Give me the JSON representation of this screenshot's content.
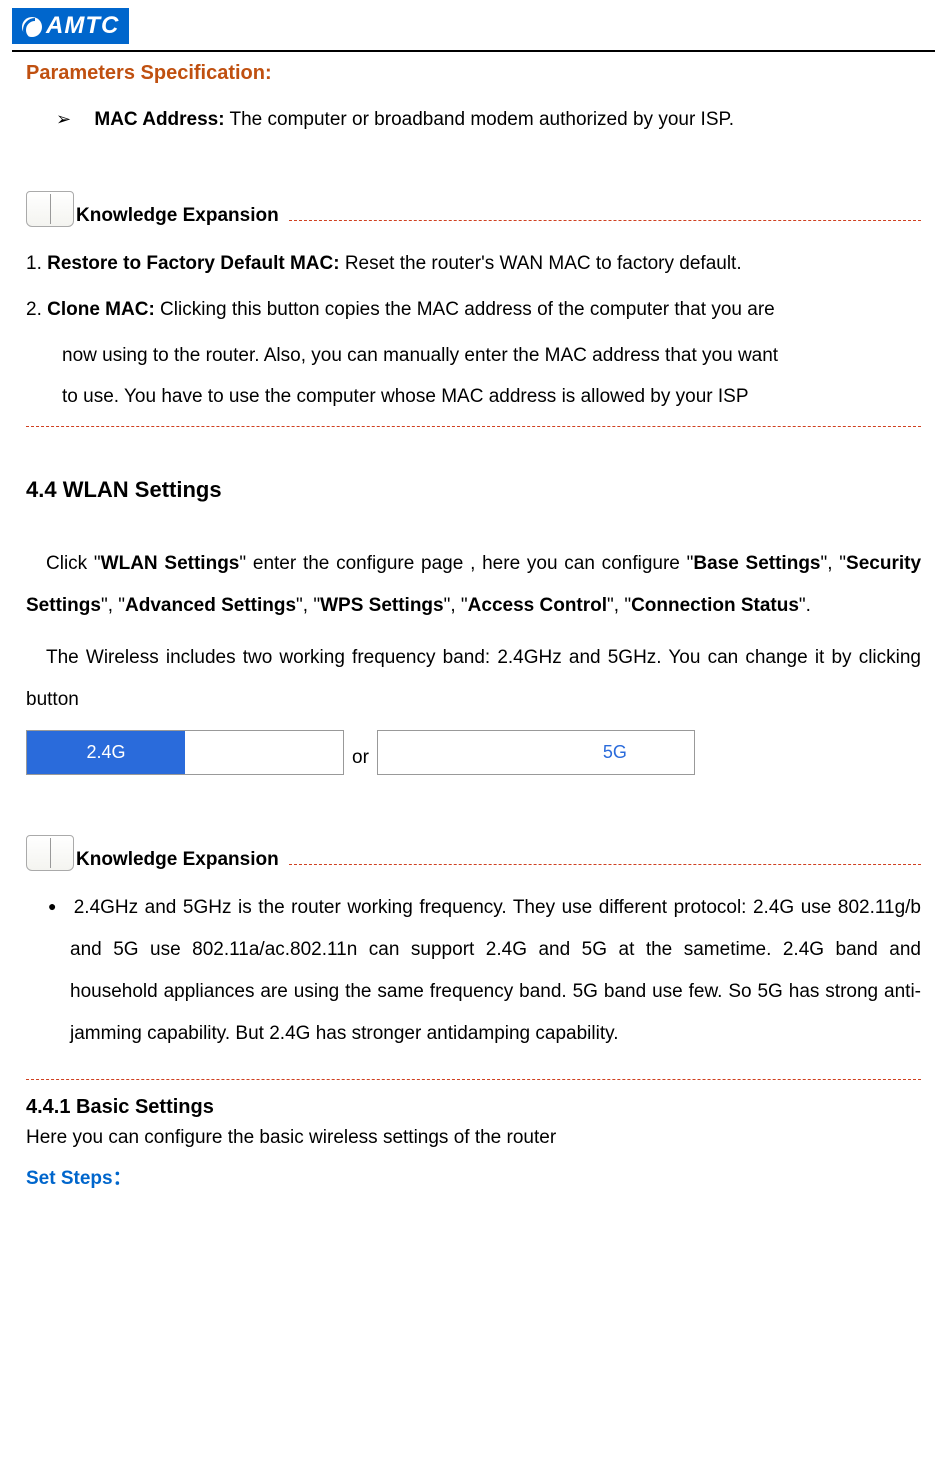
{
  "logo_text": "AMTC",
  "param_spec_title": "Parameters Specification:",
  "mac_address": {
    "label": "MAC Address:",
    "desc": " The computer or broadband modem authorized by your ISP."
  },
  "knowledge_expansion_label": "Knowledge Expansion",
  "ke1": {
    "item1_num": "1. ",
    "item1_bold": "Restore to Factory Default MAC:",
    "item1_rest": " Reset the router's WAN MAC to factory default.",
    "item2_num": "2. ",
    "item2_bold": "Clone MAC:",
    "item2_rest": " Clicking this button copies the MAC address of the computer that you are",
    "item2_cont1": "now using to the router. Also, you can manually enter the MAC address that you want",
    "item2_cont2": "to use. You have to use the computer whose MAC address is allowed by your ISP"
  },
  "section_4_4": "4.4 WLAN Settings",
  "wlan": {
    "p1_a": "Click \"",
    "p1_b": "WLAN Settings",
    "p1_c": "\" enter the configure page , here you can configure \"",
    "p1_d": "Base Settings",
    "p1_e": "\", \"",
    "p1_f": "Security Settings",
    "p1_g": "\", \"",
    "p1_h": "Advanced Settings",
    "p1_i": "\", \"",
    "p1_j": "WPS Settings",
    "p1_k": "\", \"",
    "p1_l": "Access Control",
    "p1_m": "\", \"",
    "p1_n": "Connection Status",
    "p1_o": "\".",
    "p2": "The Wireless includes two working frequency band: 2.4GHz and 5GHz. You can change it by clicking button"
  },
  "buttons": {
    "btn_24g": "2.4G",
    "or_text": "or",
    "btn_5g": "5G"
  },
  "ke2_bullet": "2.4GHz and 5GHz is the router working frequency. They use different protocol: 2.4G use 802.11g/b and 5G use 802.11a/ac.802.11n can support 2.4G and 5G at the sametime. 2.4G band and household appliances are using the same frequency band. 5G band use few. So 5G has strong anti-jamming capability. But 2.4G has stronger antidamping capability.",
  "section_4_4_1": "4.4.1 Basic Settings",
  "basic_desc": "Here you can configure the basic wireless settings of the router",
  "set_steps": "Set Steps："
}
